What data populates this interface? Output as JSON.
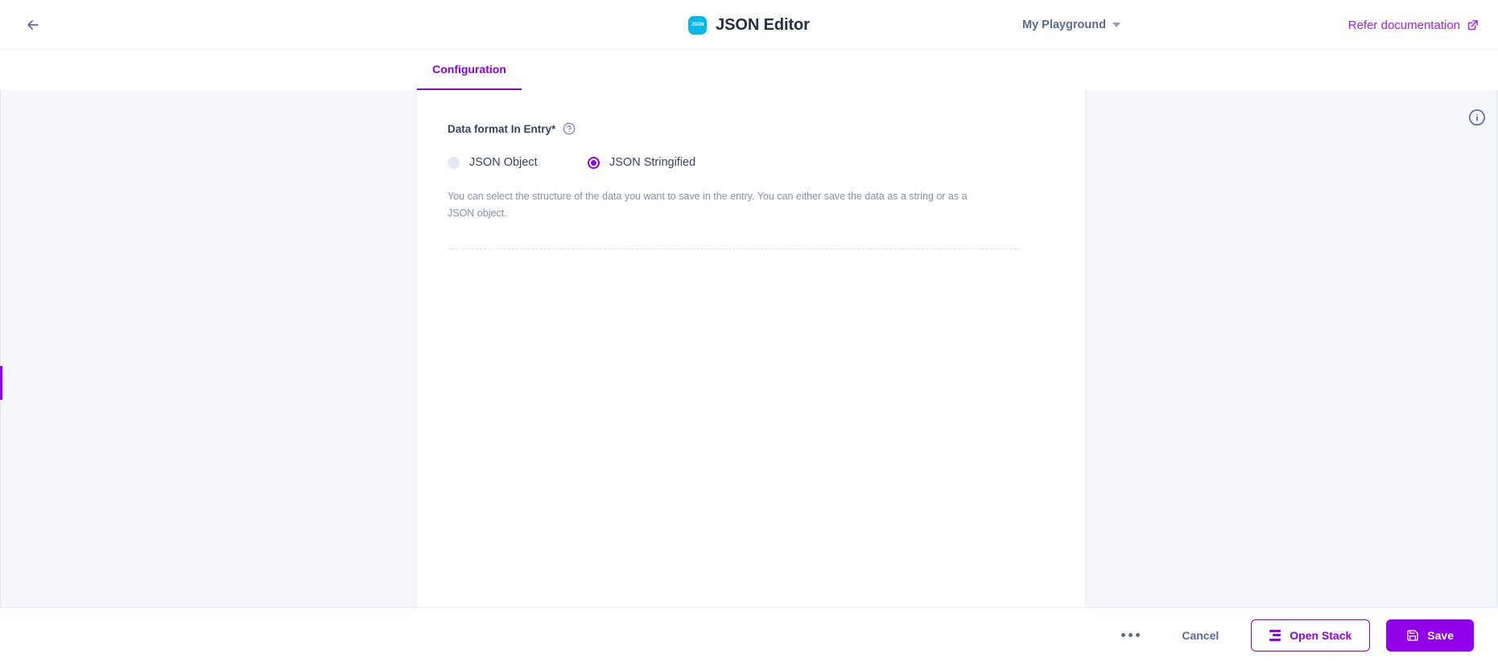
{
  "header": {
    "back_icon": "arrow-left-icon",
    "logo_text": "JSON",
    "title": "JSON Editor",
    "playground_label": "My Playground",
    "caret_icon": "chevron-down-icon",
    "refer_label": "Refer documentation",
    "external_icon": "external-link-icon"
  },
  "tabs": [
    {
      "label": "Configuration",
      "active": true
    }
  ],
  "panel": {
    "field_label": "Data format In Entry*",
    "help_icon": "question-circle-icon",
    "options": [
      {
        "label": "JSON Object",
        "selected": false
      },
      {
        "label": "JSON Stringified",
        "selected": true
      }
    ],
    "help_text": "You can select the structure of the data you want to save in the entry. You can either save the data as a string or as a JSON object."
  },
  "side": {
    "info_icon": "info-circle-icon"
  },
  "footer": {
    "kebab_icon": "more-horizontal-icon",
    "cancel_label": "Cancel",
    "open_stack_label": "Open Stack",
    "open_stack_icon": "stack-icon",
    "save_label": "Save",
    "save_icon": "floppy-disk-icon"
  },
  "colors": {
    "accent": "#9000e8",
    "tab_active": "#8b00e0",
    "logo": "#00b9e8",
    "text_dark": "#253143",
    "text_muted": "#5b6a94",
    "bg": "#f5f6fa"
  }
}
